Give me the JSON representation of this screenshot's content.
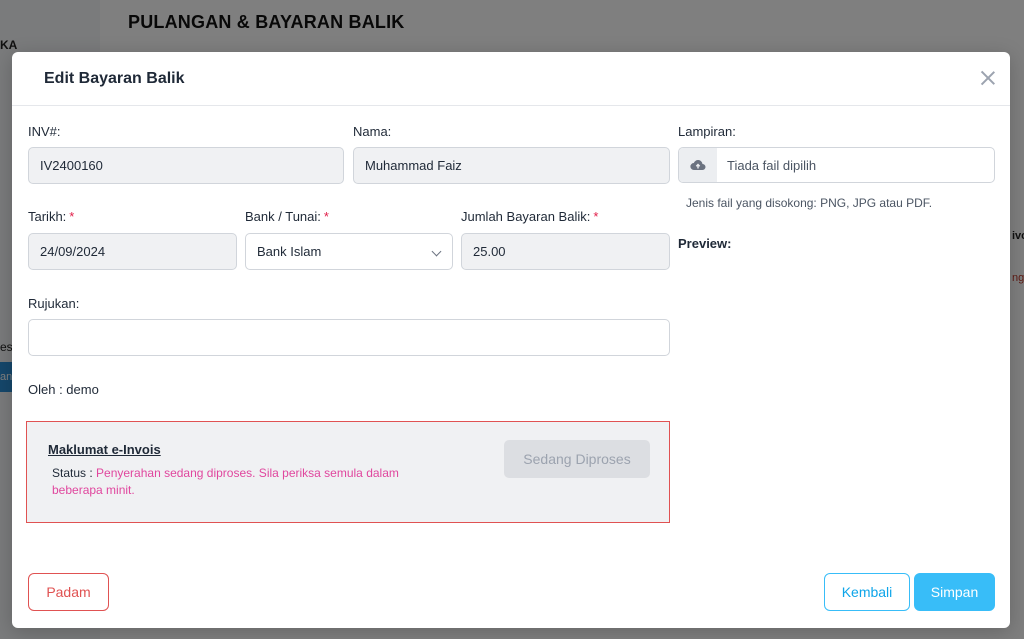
{
  "background": {
    "page_title": "PULANGAN & BAYARAN BALIK",
    "sidebar_text": "KA",
    "sidebar_text2": "esi",
    "sidebar_button": "an",
    "right_text": "ivo",
    "right_text2": "ng"
  },
  "modal": {
    "title": "Edit Bayaran Balik",
    "fields": {
      "inv": {
        "label": "INV#:",
        "value": "IV2400160"
      },
      "nama": {
        "label": "Nama:",
        "value": "Muhammad Faiz"
      },
      "tarikh": {
        "label": "Tarikh:",
        "required": "*",
        "value": "24/09/2024"
      },
      "bank": {
        "label": "Bank / Tunai:",
        "required": "*",
        "value": "Bank Islam"
      },
      "jumlah": {
        "label": "Jumlah Bayaran Balik:",
        "required": "*",
        "value": "25.00"
      },
      "rujukan": {
        "label": "Rujukan:",
        "value": ""
      }
    },
    "oleh": "Oleh : demo",
    "lampiran": {
      "label": "Lampiran:",
      "placeholder": "Tiada fail dipilih",
      "hint": "Jenis fail yang disokong: PNG, JPG atau PDF.",
      "icon": "cloud-upload-icon"
    },
    "preview_label": "Preview:",
    "einvois": {
      "title": "Maklumat e-Invois",
      "status_label": "Status :",
      "status_text": "Penyerahan sedang diproses. Sila periksa semula dalam beberapa minit.",
      "button": "Sedang Diproses"
    },
    "buttons": {
      "delete": "Padam",
      "back": "Kembali",
      "save": "Simpan"
    }
  },
  "colors": {
    "danger": "#e05252",
    "primary": "#38bdf8",
    "status_pink": "#e0479e"
  }
}
